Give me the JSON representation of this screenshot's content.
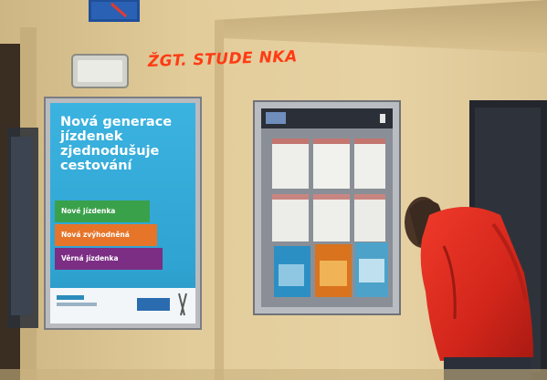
{
  "photo": {
    "description_colors": {
      "wall": "#e4cf9c",
      "poster_blue": "#33a9d6",
      "jacket_red": "#d82a1f",
      "graffiti_red": "#ff3b14"
    }
  },
  "poster": {
    "headline_lines": [
      "Nová generace",
      "jízdenek",
      "zjednodušuje",
      "cestování"
    ],
    "bands": [
      "Nové jízdenka",
      "Nová zvýhodněná jízdenka",
      "Věrná jízdenka"
    ]
  },
  "graffiti": {
    "text": "ŽGT. STUDE NKA"
  },
  "icons": {
    "sign": "parking-sign-icon",
    "light": "wall-light-icon",
    "rail_logo": "rail-logo-icon"
  }
}
